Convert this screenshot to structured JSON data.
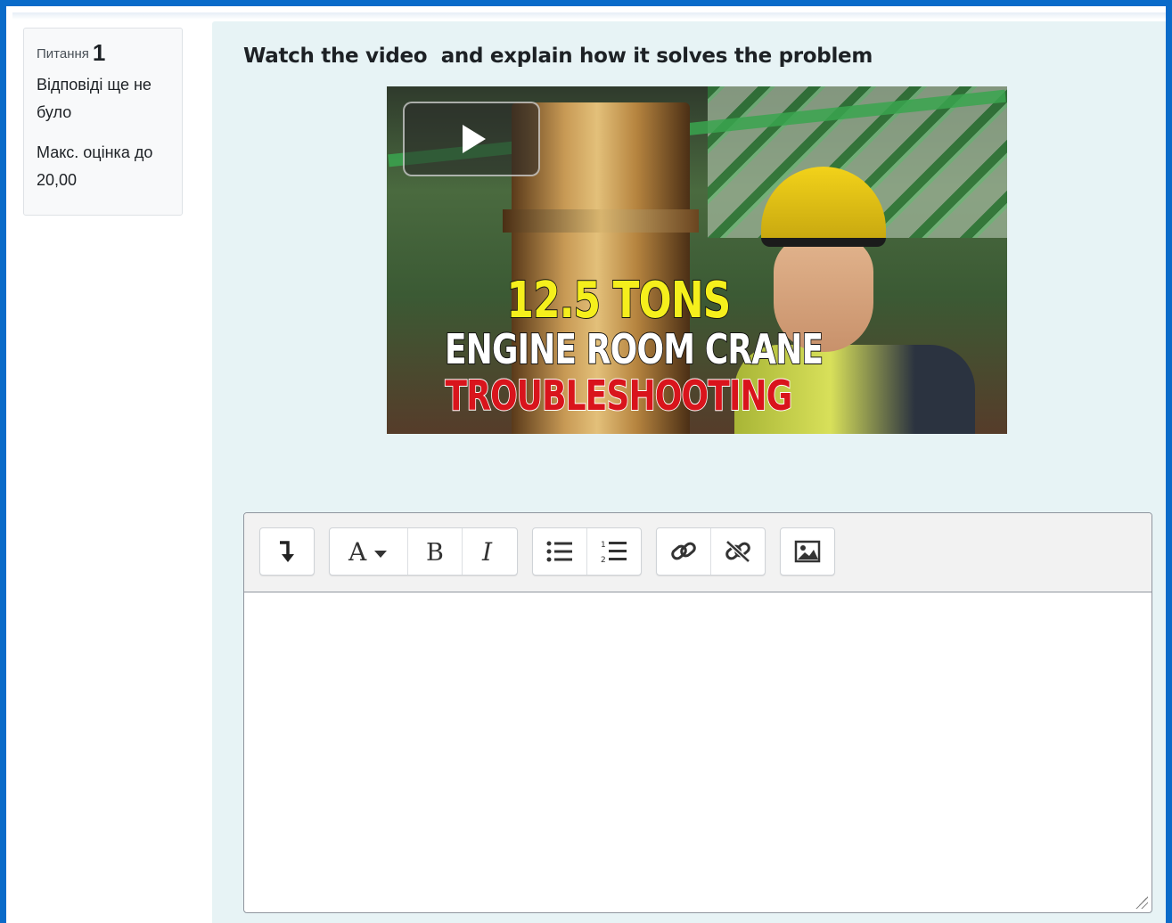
{
  "info": {
    "question_label": "Питання",
    "question_number": "1",
    "status": "Відповіді ще не було",
    "max_grade": "Макс. оцінка до 20,00"
  },
  "question": {
    "text": "Watch the video  and explain how it solves the problem"
  },
  "video": {
    "thumbnail_line1": "12.5 TONS",
    "thumbnail_line2": "ENGINE ROOM CRANE",
    "thumbnail_line3": "TROUBLESHOOTING",
    "play_icon": "play-icon"
  },
  "editor": {
    "toolbar": {
      "groups": [
        [
          "collapse-toolbar-icon"
        ],
        [
          "font-style-icon",
          "bold-icon",
          "italic-icon"
        ],
        [
          "unordered-list-icon",
          "ordered-list-icon"
        ],
        [
          "link-icon",
          "unlink-icon"
        ],
        [
          "image-icon"
        ]
      ]
    },
    "content": ""
  },
  "colors": {
    "frame": "#0a6bc9",
    "content_bg": "#e7f3f5",
    "info_bg": "#f8f9fa"
  }
}
